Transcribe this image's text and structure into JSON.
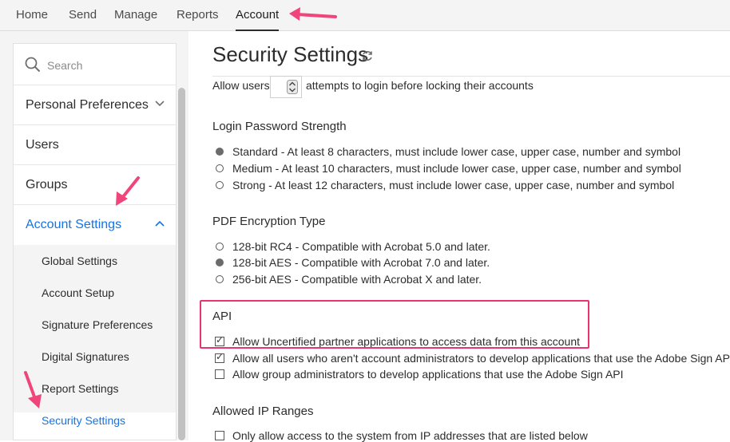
{
  "topnav": {
    "tabs": [
      {
        "label": "Home"
      },
      {
        "label": "Send"
      },
      {
        "label": "Manage"
      },
      {
        "label": "Reports"
      },
      {
        "label": "Account",
        "active": true
      }
    ]
  },
  "sidebar": {
    "search_placeholder": "Search",
    "items": [
      {
        "label": "Personal Preferences",
        "icon": "chevron-down-icon"
      },
      {
        "label": "Users"
      },
      {
        "label": "Groups"
      },
      {
        "label": "Account Settings",
        "icon": "chevron-up-icon",
        "active": true
      }
    ],
    "subitems": [
      {
        "label": "Global Settings"
      },
      {
        "label": "Account Setup"
      },
      {
        "label": "Signature Preferences"
      },
      {
        "label": "Digital Signatures"
      },
      {
        "label": "Report Settings"
      },
      {
        "label": "Security Settings",
        "active": true
      }
    ]
  },
  "main": {
    "title": "Security Settings",
    "lockout": {
      "prefix": "Allow users",
      "suffix": "attempts to login before locking their accounts"
    },
    "password_strength": {
      "heading": "Login Password Strength",
      "options": [
        {
          "label": "Standard - At least 8 characters, must include lower case, upper case, number and symbol",
          "selected": true
        },
        {
          "label": "Medium - At least 10 characters, must include lower case, upper case, number and symbol",
          "selected": false
        },
        {
          "label": "Strong - At least 12 characters, must include lower case, upper case, number and symbol",
          "selected": false
        }
      ]
    },
    "pdf_encryption": {
      "heading": "PDF Encryption Type",
      "options": [
        {
          "label": "128-bit RC4 - Compatible with Acrobat 5.0 and later.",
          "selected": false
        },
        {
          "label": "128-bit AES - Compatible with Acrobat 7.0 and later.",
          "selected": true
        },
        {
          "label": "256-bit AES - Compatible with Acrobat X and later.",
          "selected": false
        }
      ]
    },
    "api": {
      "heading": "API",
      "options": [
        {
          "label": "Allow Uncertified partner applications to access data from this account",
          "checked": true
        },
        {
          "label": "Allow all users who aren't account administrators to develop applications that use the Adobe Sign API",
          "checked": true
        },
        {
          "label": "Allow group administrators to develop applications that use the Adobe Sign API",
          "checked": false
        }
      ]
    },
    "ip_ranges": {
      "heading": "Allowed IP Ranges",
      "options": [
        {
          "label": "Only allow access to the system from IP addresses that are listed below",
          "checked": false
        }
      ]
    }
  },
  "annotations": {
    "arrow_color": "#f0457a",
    "highlight_color": "#e8356d"
  },
  "colors": {
    "accent": "#1473e6"
  }
}
